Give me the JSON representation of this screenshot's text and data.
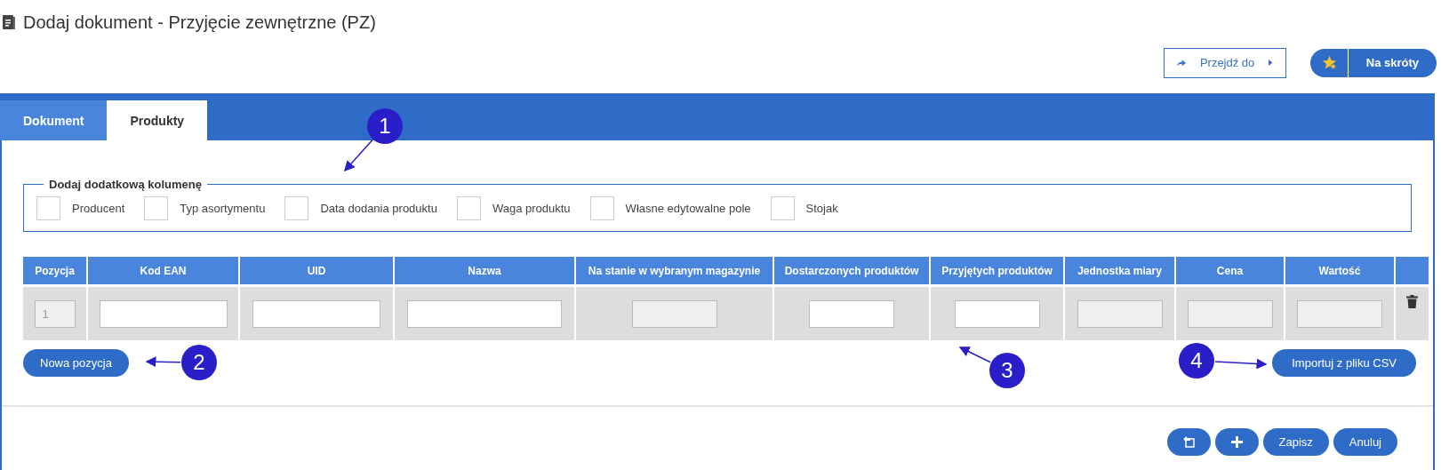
{
  "page_title": "Dodaj dokument - Przyjęcie zewnętrzne (PZ)",
  "header_buttons": {
    "goto": "Przejdź do",
    "shortcuts": "Na skróty"
  },
  "tabs": [
    {
      "label": "Dokument",
      "selected": false
    },
    {
      "label": "Produkty",
      "selected": true
    }
  ],
  "extra_columns": {
    "legend": "Dodaj dodatkową kolumenę",
    "options": [
      {
        "label": "Producent",
        "checked": false
      },
      {
        "label": "Typ asortymentu",
        "checked": false
      },
      {
        "label": "Data dodania produktu",
        "checked": false
      },
      {
        "label": "Waga produktu",
        "checked": false
      },
      {
        "label": "Własne edytowalne pole",
        "checked": false
      },
      {
        "label": "Stojak",
        "checked": false
      }
    ]
  },
  "table": {
    "columns": [
      "Pozycja",
      "Kod EAN",
      "UID",
      "Nazwa",
      "Na stanie w wybranym magazynie",
      "Dostarczonych produktów",
      "Przyjętych produktów",
      "Jednostka miary",
      "Cena",
      "Wartość"
    ],
    "rows": [
      {
        "cells": [
          {
            "kind": "readonly",
            "value": "1"
          },
          {
            "kind": "input"
          },
          {
            "kind": "input"
          },
          {
            "kind": "input"
          },
          {
            "kind": "readonly"
          },
          {
            "kind": "input"
          },
          {
            "kind": "input"
          },
          {
            "kind": "readonly"
          },
          {
            "kind": "readonly"
          },
          {
            "kind": "readonly"
          },
          {
            "kind": "delete"
          }
        ]
      }
    ]
  },
  "new_row_button": "Nowa pozycja",
  "import_button": "Importuj z pliku CSV",
  "footer_buttons": [
    {
      "kind": "icon-back"
    },
    {
      "kind": "icon-add"
    },
    {
      "kind": "text",
      "label": "Zapisz"
    },
    {
      "kind": "text",
      "label": "Anuluj"
    }
  ],
  "callouts": [
    {
      "number": "1"
    },
    {
      "number": "2"
    },
    {
      "number": "3"
    },
    {
      "number": "4"
    }
  ]
}
